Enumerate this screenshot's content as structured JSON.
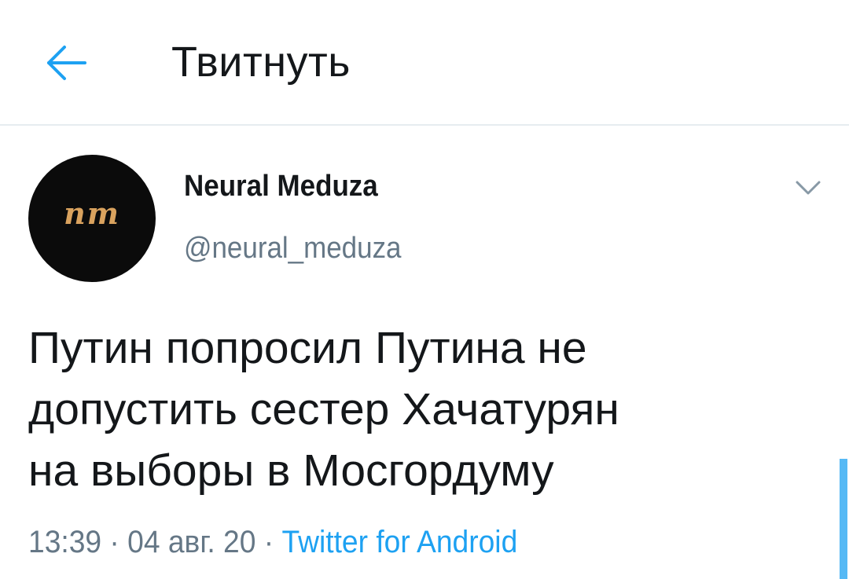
{
  "header": {
    "back_icon": "arrow-left-icon",
    "title": "Твитнуть"
  },
  "tweet": {
    "author": {
      "avatar_text": "nm",
      "display_name": "Neural Meduza",
      "handle": "@neural_meduza"
    },
    "caret_icon": "chevron-down-icon",
    "text_lines": [
      "Путин попросил Путина не",
      "допустить сестер Хачатурян",
      "на выборы в Мосгордуму"
    ],
    "meta": {
      "time": "13:39",
      "sep1": " · ",
      "date": "04 авг. 20",
      "sep2": " · ",
      "source": "Twitter for Android"
    }
  },
  "colors": {
    "accent": "#1da1f2",
    "text": "#14171a",
    "secondary": "#657786",
    "divider": "#e6ecf0",
    "avatar_bg": "#0b0b0b",
    "avatar_logo": "#d9a25e"
  }
}
